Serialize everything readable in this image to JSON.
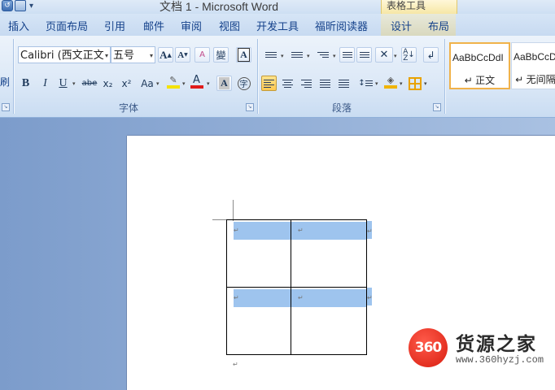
{
  "window": {
    "title": "文档 1 - Microsoft Word",
    "context_tab_header": "表格工具"
  },
  "quick_access": {
    "icons": [
      "undo-icon",
      "save-icon"
    ],
    "more": "▾"
  },
  "tabs": [
    "插入",
    "页面布局",
    "引用",
    "邮件",
    "审阅",
    "视图",
    "开发工具",
    "福昕阅读器",
    "设计",
    "布局"
  ],
  "ribbon": {
    "left_stub": "刷",
    "font_group": {
      "label": "字体",
      "font_name": "Calibri (西文正文",
      "font_size": "五号",
      "buttons": {
        "grow": "A",
        "shrink": "A",
        "clear": "A",
        "bold": "B",
        "italic": "I",
        "underline": "U",
        "strike": "abe",
        "subscript": "x₂",
        "superscript": "x²",
        "case": "Aa",
        "font_color": "A",
        "char_shading": "A",
        "enclose": "字",
        "phonetic": "變",
        "border": "A"
      },
      "highlight_color": "#f4e200",
      "font_color_bar": "#e01b1b"
    },
    "paragraph_group": {
      "label": "段落",
      "shading_color": "#f0b400"
    },
    "styles": [
      {
        "sample": "AaBbCcDdI",
        "name": "↵ 正文",
        "selected": true
      },
      {
        "sample": "AaBbCcD",
        "name": "↵ 无间隔",
        "selected": false
      }
    ]
  },
  "document": {
    "paragraph_mark": "↵",
    "table": {
      "rows": 2,
      "cols": 2,
      "highlight_color": "#9ec4ee"
    }
  },
  "watermark": {
    "badge": "360",
    "title": "货源之家",
    "url": "www.360hyzj.com"
  }
}
